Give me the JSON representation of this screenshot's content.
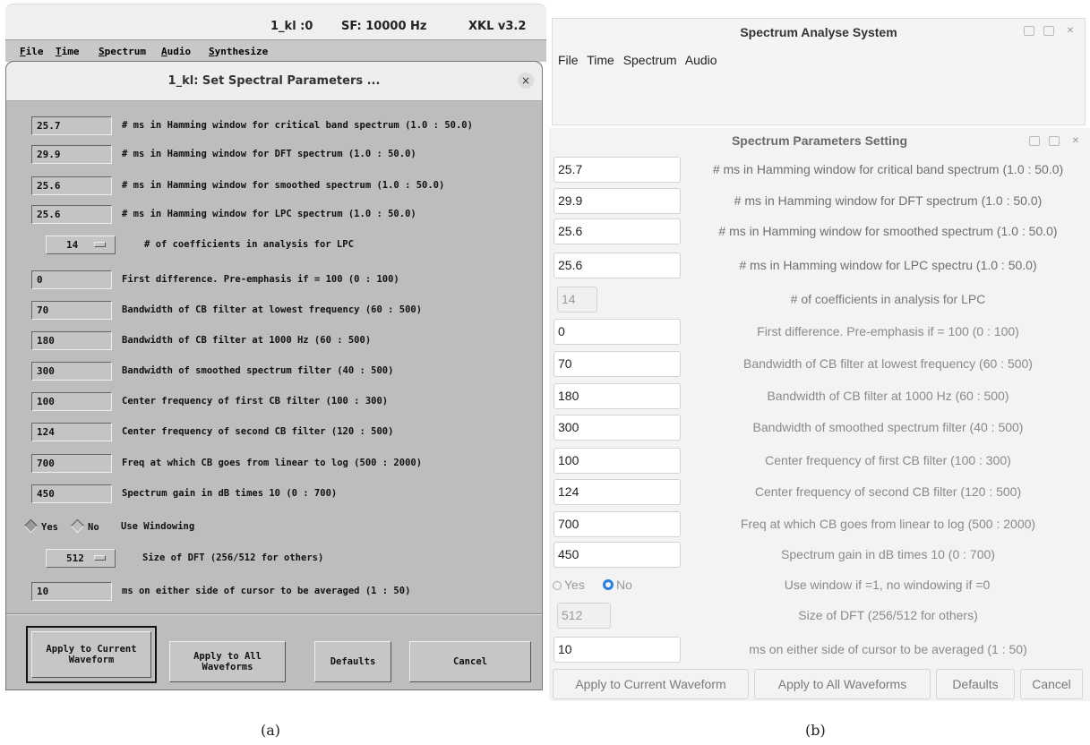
{
  "panel_a": {
    "top_bar": {
      "filename": "1_kl :0",
      "sample_rate": "SF: 10000 Hz",
      "version": "XKL v3.2"
    },
    "menu": [
      "File",
      "Time",
      "Spectrum",
      "Audio",
      "Synthesize"
    ],
    "dialog_title": "1_kl:  Set Spectral Parameters ...",
    "close_glyph": "×",
    "rows": [
      {
        "value": "25.7",
        "label": "# ms in Hamming window for critical band spectrum  (1.0 : 50.0)"
      },
      {
        "value": "29.9",
        "label": "# ms in Hamming window for DFT spectrum  (1.0 : 50.0)"
      },
      {
        "value": "25.6",
        "label": "# ms in Hamming window for smoothed spectrum  (1.0 : 50.0)"
      },
      {
        "value": "25.6",
        "label": "# ms in Hamming window for LPC spectrum  (1.0 : 50.0)"
      },
      {
        "value": "14",
        "label": "# of coefficients in analysis for LPC"
      },
      {
        "value": "0",
        "label": "First difference. Pre-emphasis if = 100  (0 : 100)"
      },
      {
        "value": "70",
        "label": "Bandwidth of CB filter at lowest frequency  (60 : 500)"
      },
      {
        "value": "180",
        "label": "Bandwidth of CB filter at 1000 Hz  (60 : 500)"
      },
      {
        "value": "300",
        "label": "Bandwidth of smoothed spectrum filter  (40 : 500)"
      },
      {
        "value": "100",
        "label": "Center frequency of first CB filter  (100 : 300)"
      },
      {
        "value": "124",
        "label": "Center frequency of second CB filter  (120 : 500)"
      },
      {
        "value": "700",
        "label": "Freq at which CB goes from linear to log  (500 : 2000)"
      },
      {
        "value": "450",
        "label": "Spectrum gain in dB times 10  (0 : 700)"
      },
      {
        "yes": "Yes",
        "no": "No",
        "label": "Use Windowing"
      },
      {
        "value": "512",
        "label": "Size of DFT (256/512 for others)"
      },
      {
        "value": "10",
        "label": "ms on either side of cursor to be averaged  (1 : 50)"
      }
    ],
    "buttons": {
      "apply_current_1": "Apply to Current",
      "apply_current_2": "Waveform",
      "apply_all_1": "Apply to All",
      "apply_all_2": "Waveforms",
      "defaults": "Defaults",
      "cancel": "Cancel"
    }
  },
  "panel_b": {
    "window_title": "Spectrum Analyse System",
    "menu": [
      "File",
      "Time",
      "Spectrum",
      "Audio"
    ],
    "dialog_title": "Spectrum Parameters Setting",
    "rows": [
      {
        "value": "25.7",
        "label": "# ms in Hamming window for critical band spectrum (1.0 : 50.0)"
      },
      {
        "value": "29.9",
        "label": "# ms in Hamming window for DFT spectrum (1.0 : 50.0)"
      },
      {
        "value": "25.6",
        "label": "# ms in Hamming window for smoothed spectrum (1.0 : 50.0)"
      },
      {
        "value": "25.6",
        "label": "# ms in Hamming window for LPC spectru (1.0 : 50.0)"
      },
      {
        "value": "14",
        "label": "# of coefficients in analysis for LPC"
      },
      {
        "value": "0",
        "label": "First difference. Pre-emphasis if = 100 (0 : 100)"
      },
      {
        "value": "70",
        "label": "Bandwidth of CB filter at lowest frequency (60 : 500)"
      },
      {
        "value": "180",
        "label": "Bandwidth of CB filter at 1000 Hz (60 : 500)"
      },
      {
        "value": "300",
        "label": "Bandwidth of smoothed spectrum filter (40 : 500)"
      },
      {
        "value": "100",
        "label": "Center frequency of first CB filter (100 : 300)"
      },
      {
        "value": "124",
        "label": "Center frequency of second CB filter (120 : 500)"
      },
      {
        "value": "700",
        "label": "Freq at which CB goes from linear to log (500 : 2000)"
      },
      {
        "value": "450",
        "label": "Spectrum gain in dB times 10 (0 : 700)"
      },
      {
        "yes": "Yes",
        "no": "No",
        "label": "Use window if =1, no windowing if =0"
      },
      {
        "value": "512",
        "label": "Size of DFT (256/512 for others)"
      },
      {
        "value": "10",
        "label": "ms on either side of cursor to be averaged (1 : 50)"
      }
    ],
    "buttons": {
      "apply_current": "Apply to Current Waveform",
      "apply_all": "Apply to All Waveforms",
      "defaults": "Defaults",
      "cancel": "Cancel"
    },
    "close_glyph": "✕"
  },
  "captions": {
    "a": "(a)",
    "b": "(b)"
  }
}
